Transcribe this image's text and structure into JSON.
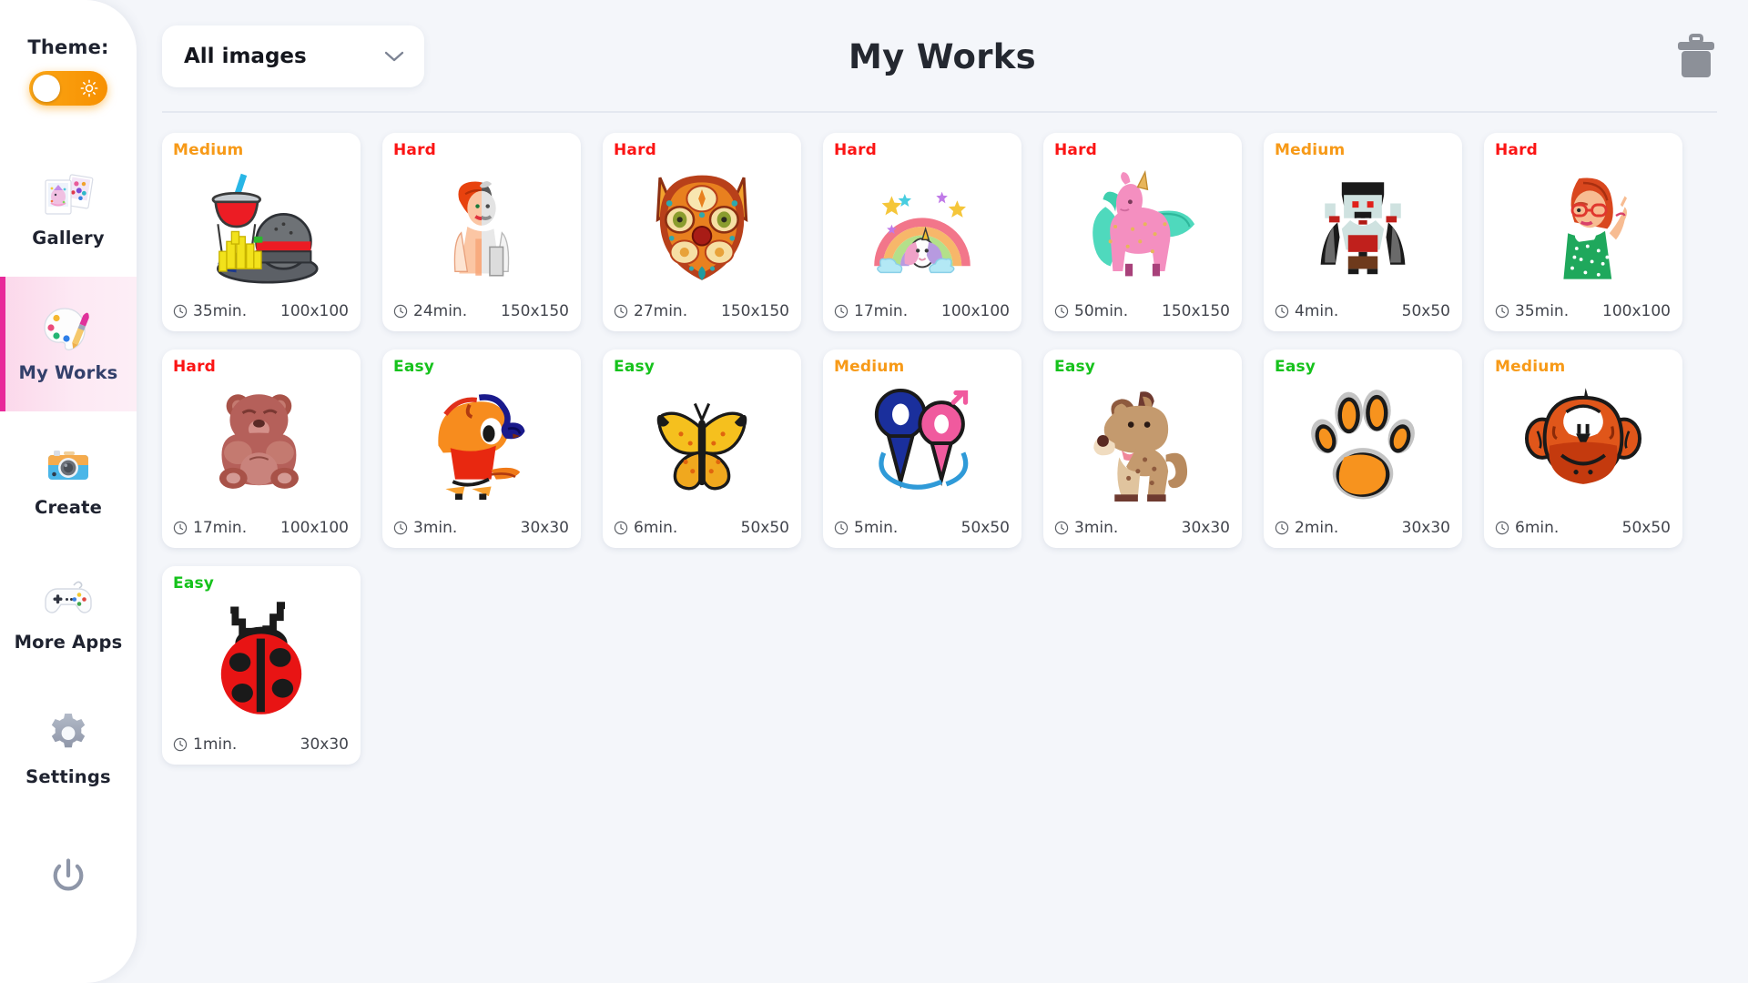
{
  "sidebar": {
    "theme": {
      "label": "Theme:",
      "state": "light",
      "icon": "sun-icon"
    },
    "items": [
      {
        "label": "Gallery",
        "icon": "photos-icon",
        "active": false
      },
      {
        "label": "My Works",
        "icon": "palette-icon",
        "active": true
      },
      {
        "label": "Create",
        "icon": "camera-icon",
        "active": false
      },
      {
        "label": "More Apps",
        "icon": "gamepad-icon",
        "active": false
      },
      {
        "label": "Settings",
        "icon": "gear-icon",
        "active": false
      }
    ],
    "power": {
      "icon": "power-icon"
    }
  },
  "header": {
    "title": "My Works",
    "filter": {
      "value": "All images",
      "icon": "chevron-down-icon"
    },
    "delete": {
      "icon": "trash-icon"
    }
  },
  "colors": {
    "easy": "#16c21c",
    "medium": "#f79a18",
    "hard": "#fb1414",
    "accent_pink": "#e8299a",
    "toggle_orange": "#f79000",
    "page_bg": "#f4f6fa",
    "card_bg": "#ffffff"
  },
  "works": [
    {
      "difficulty": "Medium",
      "level": "medium",
      "time": "35min.",
      "size": "100x100",
      "art": "burger"
    },
    {
      "difficulty": "Hard",
      "level": "hard",
      "time": "24min.",
      "size": "150x150",
      "art": "woman-drink"
    },
    {
      "difficulty": "Hard",
      "level": "hard",
      "time": "27min.",
      "size": "150x150",
      "art": "ornate-cat"
    },
    {
      "difficulty": "Hard",
      "level": "hard",
      "time": "17min.",
      "size": "100x100",
      "art": "rainbow-unicorn"
    },
    {
      "difficulty": "Hard",
      "level": "hard",
      "time": "50min.",
      "size": "150x150",
      "art": "pink-unicorn"
    },
    {
      "difficulty": "Medium",
      "level": "medium",
      "time": "4min.",
      "size": "50x50",
      "art": "vampire"
    },
    {
      "difficulty": "Hard",
      "level": "hard",
      "time": "35min.",
      "size": "100x100",
      "art": "green-dress-woman"
    },
    {
      "difficulty": "Hard",
      "level": "hard",
      "time": "17min.",
      "size": "100x100",
      "art": "bear"
    },
    {
      "difficulty": "Easy",
      "level": "easy",
      "time": "3min.",
      "size": "30x30",
      "art": "orange-bird"
    },
    {
      "difficulty": "Easy",
      "level": "easy",
      "time": "6min.",
      "size": "50x50",
      "art": "butterfly"
    },
    {
      "difficulty": "Medium",
      "level": "medium",
      "time": "5min.",
      "size": "50x50",
      "art": "gender-symbols"
    },
    {
      "difficulty": "Easy",
      "level": "easy",
      "time": "3min.",
      "size": "30x30",
      "art": "dog"
    },
    {
      "difficulty": "Easy",
      "level": "easy",
      "time": "2min.",
      "size": "30x30",
      "art": "paw-print"
    },
    {
      "difficulty": "Medium",
      "level": "medium",
      "time": "6min.",
      "size": "50x50",
      "art": "monkey"
    },
    {
      "difficulty": "Easy",
      "level": "easy",
      "time": "1min.",
      "size": "30x30",
      "art": "ladybug"
    }
  ]
}
